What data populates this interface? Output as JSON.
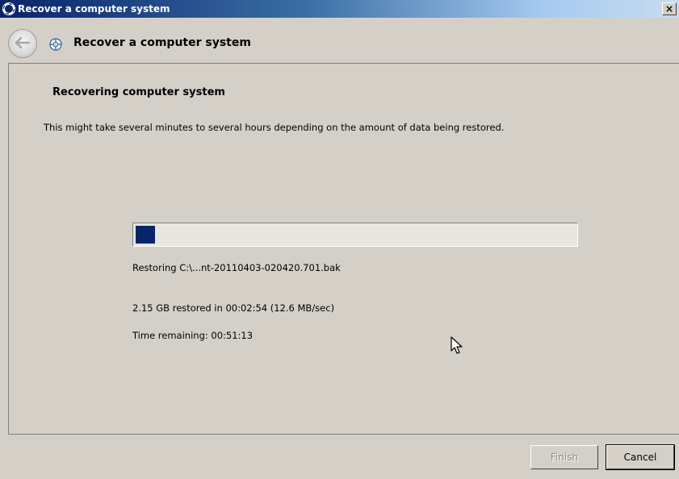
{
  "window": {
    "title": "Recover a computer system",
    "close_glyph": "×"
  },
  "header": {
    "title": "Recover a computer system",
    "back_icon": "back-arrow-icon",
    "app_icon": "recovery-icon"
  },
  "content": {
    "heading": "Recovering computer system",
    "description": "This might take several minutes to several hours depending on the amount of data being restored.",
    "progress_percent": 4.5,
    "restoring_text": "Restoring C:\\...nt-20110403-020420.701.bak",
    "restored_text": "2.15 GB restored in 00:02:54 (12.6 MB/sec)",
    "remaining_text": "Time remaining: 00:51:13"
  },
  "buttons": {
    "finish_label": "Finish",
    "finish_enabled": false,
    "cancel_label": "Cancel"
  },
  "colors": {
    "progress_fill": "#0a246a",
    "titlebar_start": "#0a246a",
    "face": "#d4d0c8"
  }
}
